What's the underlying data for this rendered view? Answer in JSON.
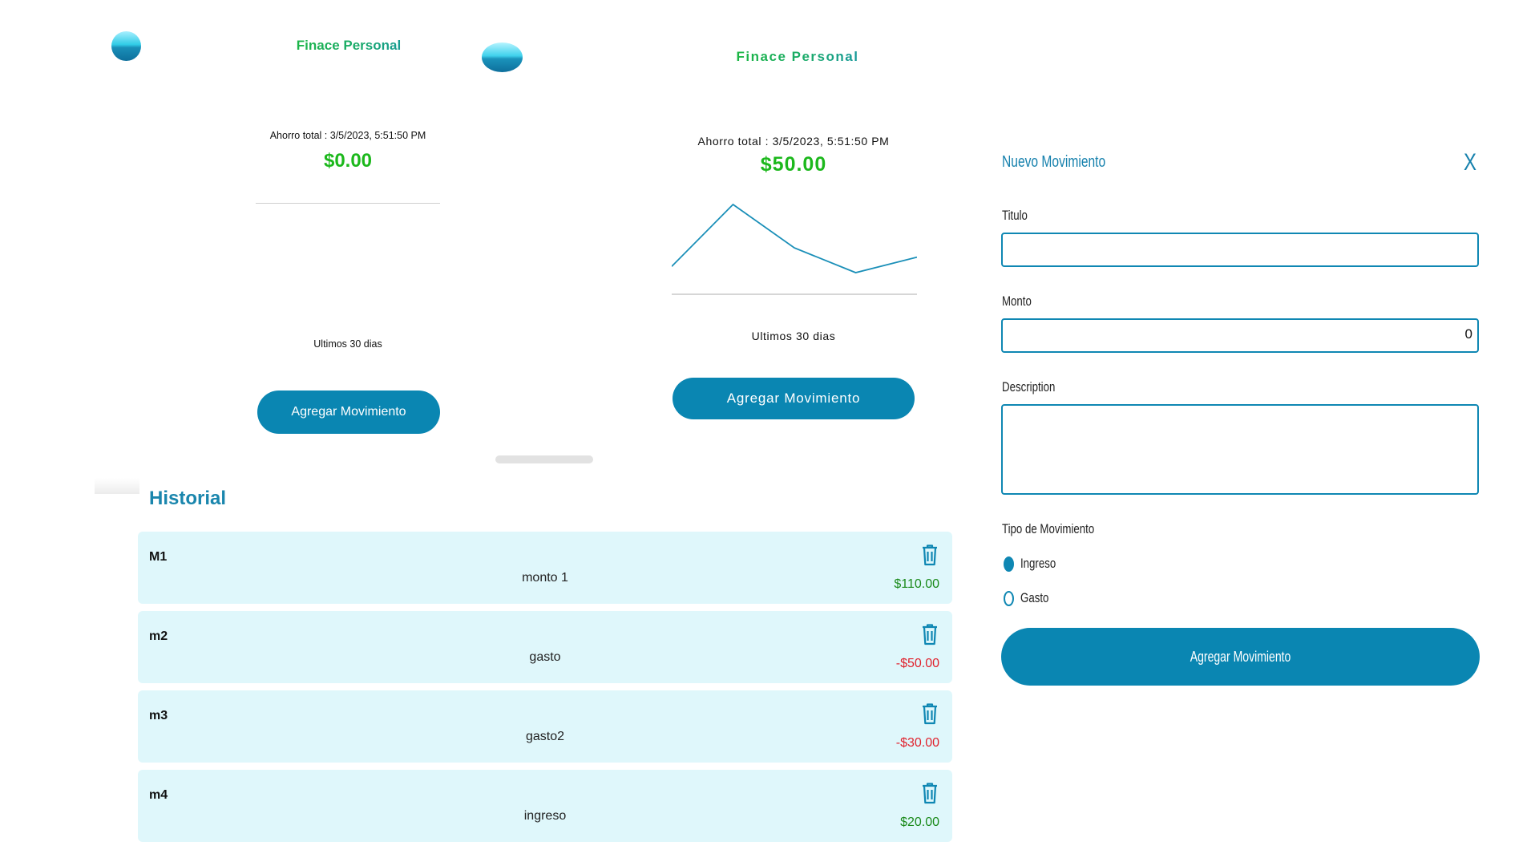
{
  "left_panel": {
    "brand": "Finace Personal",
    "savings_label": "Ahorro total : 3/5/2023, 5:51:50 PM",
    "savings_value": "$0.00",
    "period_label": "Ultimos 30 dias",
    "add_button": "Agregar Movimiento"
  },
  "middle_panel": {
    "brand": "Finace Personal",
    "savings_label": "Ahorro total : 3/5/2023, 5:51:50 PM",
    "savings_value": "$50.00",
    "period_label": "Ultimos 30 dias",
    "add_button": "Agregar Movimiento"
  },
  "chart_data": {
    "type": "line",
    "x": [
      1,
      2,
      3,
      4,
      5
    ],
    "values": [
      10,
      110,
      40,
      0,
      25
    ],
    "title": "",
    "xlabel": "",
    "ylabel": "",
    "grid": false,
    "color": "#1a8fb8"
  },
  "history": {
    "title": "Historial",
    "items": [
      {
        "title": "M1",
        "description": "monto 1",
        "amount": "$110.00",
        "type": "pos"
      },
      {
        "title": "m2",
        "description": "gasto",
        "amount": "-$50.00",
        "type": "neg"
      },
      {
        "title": "m3",
        "description": "gasto2",
        "amount": "-$30.00",
        "type": "neg"
      },
      {
        "title": "m4",
        "description": "ingreso",
        "amount": "$20.00",
        "type": "pos"
      }
    ]
  },
  "form": {
    "title": "Nuevo Movimiento",
    "close": "X",
    "titulo_label": "Titulo",
    "titulo_value": "",
    "monto_label": "Monto",
    "monto_value": "0",
    "description_label": "Description",
    "description_value": "",
    "tipo_label": "Tipo de Movimiento",
    "option_ingreso": "Ingreso",
    "option_gasto": "Gasto",
    "selected": "Ingreso",
    "submit": "Agregar Movimiento"
  },
  "colors": {
    "accent": "#0a86b2",
    "positive": "#1cb81c",
    "negative": "#e0232e",
    "card_bg": "#dff7fb"
  }
}
